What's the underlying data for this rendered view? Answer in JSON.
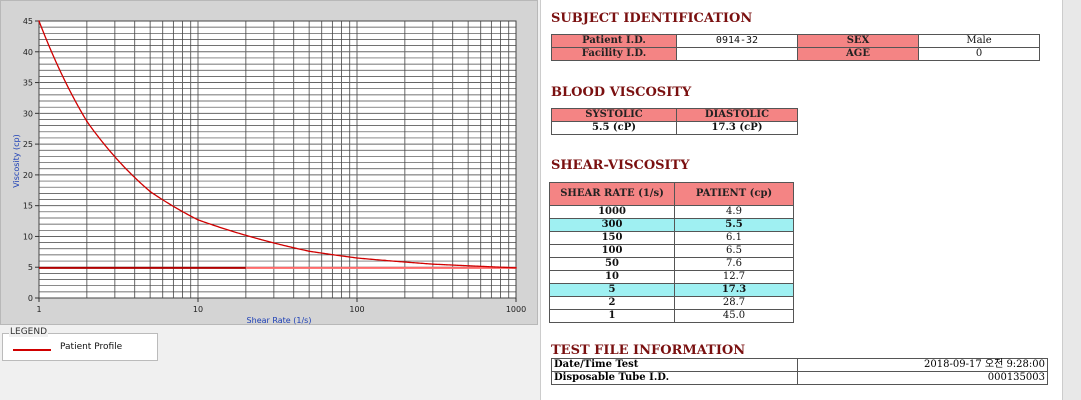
{
  "legend": {
    "title": "LEGEND",
    "label": "Patient Profile"
  },
  "subject": {
    "title": "SUBJECT IDENTIFICATION",
    "patient_id_label": "Patient I.D.",
    "patient_id": "0914-32",
    "facility_id_label": "Facility I.D.",
    "facility_id": "",
    "sex_label": "SEX",
    "sex": "Male",
    "age_label": "AGE",
    "age": "0"
  },
  "blood": {
    "title": "BLOOD VISCOSITY",
    "systolic_label": "SYSTOLIC",
    "diastolic_label": "DIASTOLIC",
    "systolic": "5.5 (cP)",
    "diastolic": "17.3 (cP)"
  },
  "shear": {
    "title": "SHEAR-VISCOSITY",
    "col_rate": "SHEAR RATE (1/s)",
    "col_patient": "PATIENT (cp)",
    "rows": [
      {
        "rate": "1000",
        "patient": "4.9"
      },
      {
        "rate": "300",
        "patient": "5.5"
      },
      {
        "rate": "150",
        "patient": "6.1"
      },
      {
        "rate": "100",
        "patient": "6.5"
      },
      {
        "rate": "50",
        "patient": "7.6"
      },
      {
        "rate": "10",
        "patient": "12.7"
      },
      {
        "rate": "5",
        "patient": "17.3"
      },
      {
        "rate": "2",
        "patient": "28.7"
      },
      {
        "rate": "1",
        "patient": "45.0"
      }
    ]
  },
  "testfile": {
    "title": "TEST FILE INFORMATION",
    "date_label": "Date/Time Test",
    "date_value": "2018-09-17  오전 9:28:00",
    "tube_label": "Disposable Tube I.D.",
    "tube_value": "000135003"
  },
  "chart_data": {
    "type": "line",
    "xlabel": "Shear Rate (1/s)",
    "ylabel": "Viscosity (cp)",
    "xscale": "log",
    "xlim": [
      1,
      1000
    ],
    "ylim": [
      0,
      45
    ],
    "xticks": [
      "1",
      "10",
      "100",
      "1000"
    ],
    "yticks": [
      "0",
      "5",
      "10",
      "15",
      "20",
      "25",
      "30",
      "35",
      "40",
      "45"
    ],
    "grid": true,
    "series": [
      {
        "name": "Patient Profile",
        "color": "#d00000",
        "x": [
          1,
          2,
          5,
          10,
          50,
          100,
          150,
          300,
          1000
        ],
        "y": [
          45.0,
          28.7,
          17.3,
          12.7,
          7.6,
          6.5,
          6.1,
          5.5,
          4.9
        ]
      }
    ],
    "reference_lines": [
      {
        "color": "#b00000",
        "y": 4.9,
        "x_range": [
          1,
          20
        ]
      },
      {
        "color": "#ff6a6a",
        "y": 4.9,
        "x_range": [
          20,
          1000
        ]
      }
    ]
  }
}
